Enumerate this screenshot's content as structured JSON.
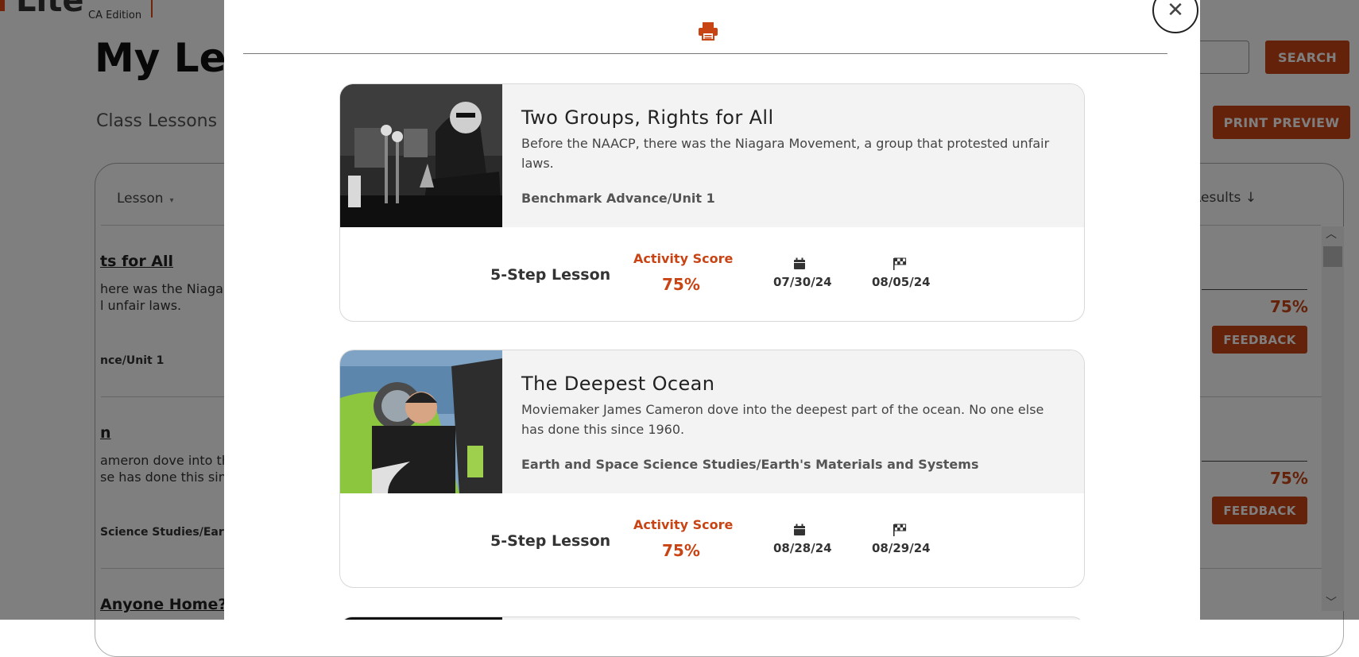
{
  "app": {
    "logo_text": "Lite",
    "edition": "CA Edition",
    "page_title": "My Lessons",
    "search_button": "SEARCH",
    "print_preview_button": "PRINT PREVIEW",
    "section_title": "Class Lessons"
  },
  "table": {
    "col_lesson": "Lesson",
    "col_results": "Results ↓",
    "rows": [
      {
        "title_fragment": "ts for All",
        "desc_line1": "here was the Niagara",
        "desc_line2": "l unfair laws.",
        "unit_fragment": "nce/Unit 1",
        "score": "75%",
        "feedback": "FEEDBACK"
      },
      {
        "title_fragment": "n",
        "desc_line1": "ameron dove into th",
        "desc_line2": "se has done this sinc",
        "unit_fragment": "Science Studies/Earth'",
        "score": "75%",
        "feedback": "FEEDBACK"
      },
      {
        "title_fragment": "Anyone Home?"
      }
    ]
  },
  "modal": {
    "print_icon": "print-icon",
    "close_icon": "close-icon",
    "close_symbol": "✕",
    "cards": [
      {
        "title": "Two Groups, Rights for All",
        "description": "Before the NAACP, there was the Niagara Movement, a group that protested unfair laws.",
        "unit": "Benchmark Advance/Unit 1",
        "lesson_type": "5-Step Lesson",
        "score_label": "Activity Score",
        "score": "75%",
        "assigned_date": "07/30/24",
        "due_date": "08/05/24"
      },
      {
        "title": "The Deepest Ocean",
        "description": "Moviemaker James Cameron dove into the deepest part of the ocean. No one else has done this since 1960.",
        "unit": "Earth and Space Science Studies/Earth's Materials and Systems",
        "lesson_type": "5-Step Lesson",
        "score_label": "Activity Score",
        "score": "75%",
        "assigned_date": "08/28/24",
        "due_date": "08/29/24"
      }
    ]
  },
  "colors": {
    "accent": "#c94414",
    "overlay": "rgba(0,0,0,0.5)",
    "card_header_bg": "#f3f3f3"
  }
}
